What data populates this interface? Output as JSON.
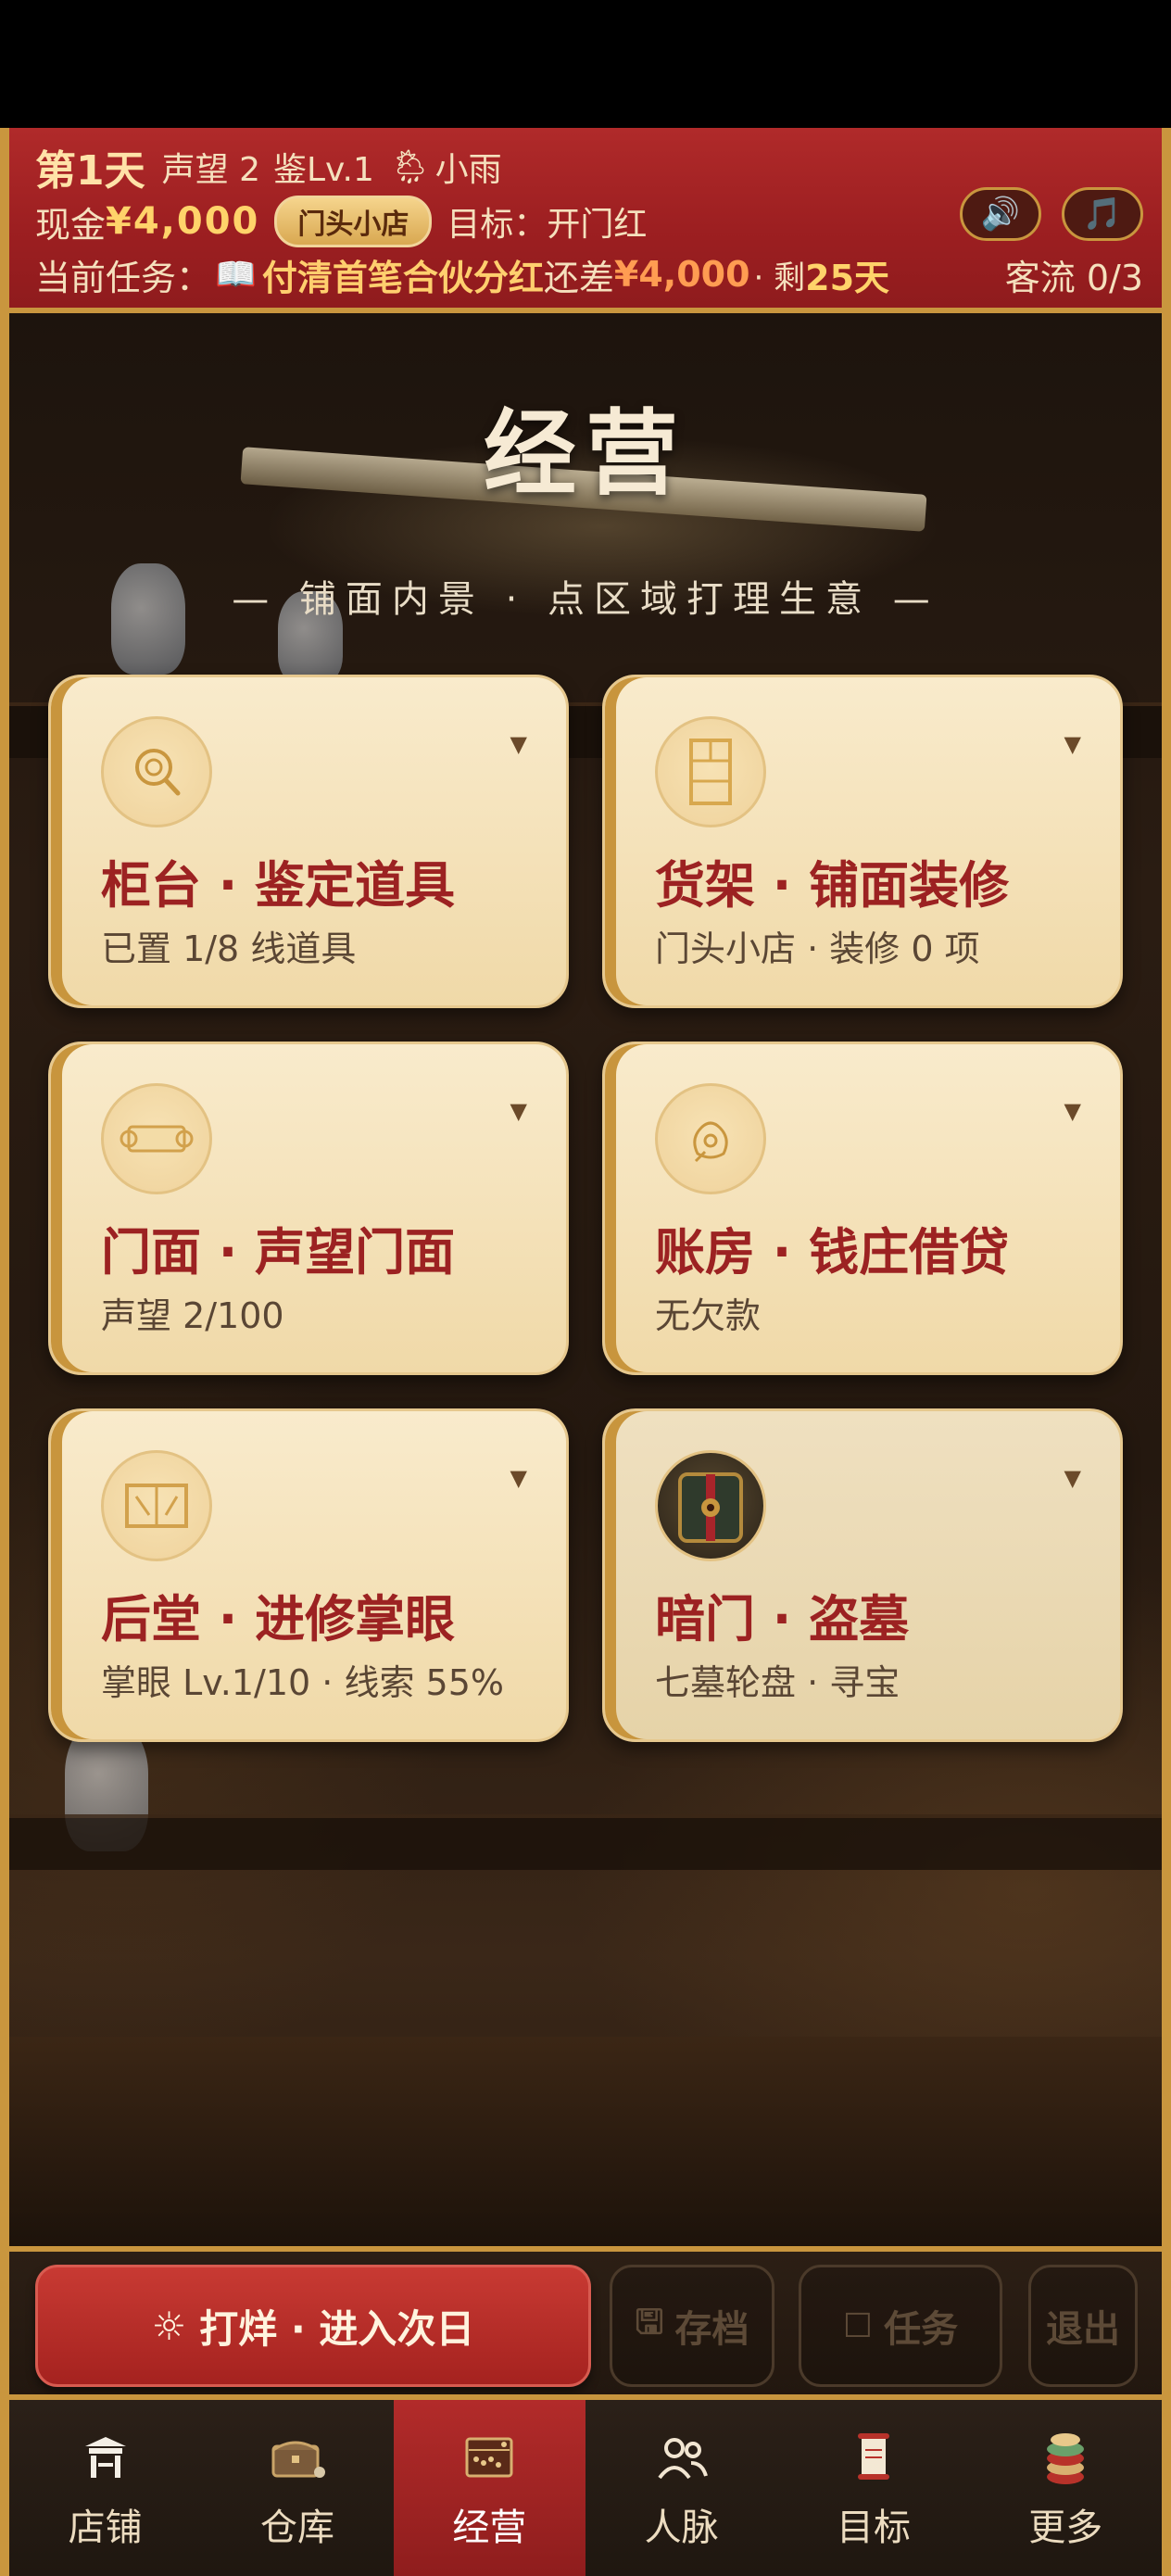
{
  "hud": {
    "day": "第1天",
    "reputation": "声望 2",
    "appraisal_level": "鉴Lv.1",
    "weather_icon": "🌦",
    "weather": "小雨",
    "cash_label": "现金",
    "cash_value": "¥4,000",
    "shop_badge": "门头小店",
    "goal": "目标：开门红",
    "sound_icon": "🔊",
    "music_icon": "🎵",
    "task_label": "当前任务：",
    "task_icon": "📖",
    "task_name": "付清首笔合伙分红",
    "task_shortfall_label": "还差",
    "task_shortfall_value": "¥4,000",
    "task_remaining_label": "· 剩",
    "task_remaining_days": "25天",
    "visitors": "客流 0/3"
  },
  "main": {
    "title": "经营",
    "subtitle": "— 铺面内景 · 点区域打理生意 —",
    "arrow": "▼",
    "cards": [
      {
        "icon": "magnifier-coin-icon",
        "title": "柜台 · 鉴定道具",
        "sub": "已置 1/8 线道具"
      },
      {
        "icon": "cabinet-icon",
        "title": "货架 · 铺面装修",
        "sub": "门头小店 · 装修 0 项"
      },
      {
        "icon": "scroll-icon",
        "title": "门面 · 声望门面",
        "sub": "声望 2/100"
      },
      {
        "icon": "money-bag-icon",
        "title": "账房 · 钱庄借贷",
        "sub": "无欠款"
      },
      {
        "icon": "book-icon",
        "title": "后堂 · 进修掌眼",
        "sub": "掌眼 Lv.1/10 · 线索 55%"
      },
      {
        "icon": "treasure-chest-icon",
        "title": "暗门 · 盗墓",
        "sub": "七墓轮盘 · 寻宝"
      }
    ]
  },
  "actions": {
    "next_day_icon": "☼",
    "next_day": "打烊 · 进入次日",
    "save_icon": "🖫",
    "save": "存档",
    "tasks_icon": "☐",
    "tasks": "任务",
    "exit": "退出"
  },
  "nav": [
    {
      "label": "店铺",
      "icon": "shop-icon"
    },
    {
      "label": "仓库",
      "icon": "warehouse-chest-icon"
    },
    {
      "label": "经营",
      "icon": "abacus-icon",
      "active": true
    },
    {
      "label": "人脉",
      "icon": "people-icon"
    },
    {
      "label": "目标",
      "icon": "target-scroll-icon"
    },
    {
      "label": "更多",
      "icon": "more-coins-icon"
    }
  ],
  "colors": {
    "hud_red": "#9d1f21",
    "gold_border": "#c9963e",
    "card_title_red": "#9c2222",
    "active_nav": "#b22b2a"
  }
}
